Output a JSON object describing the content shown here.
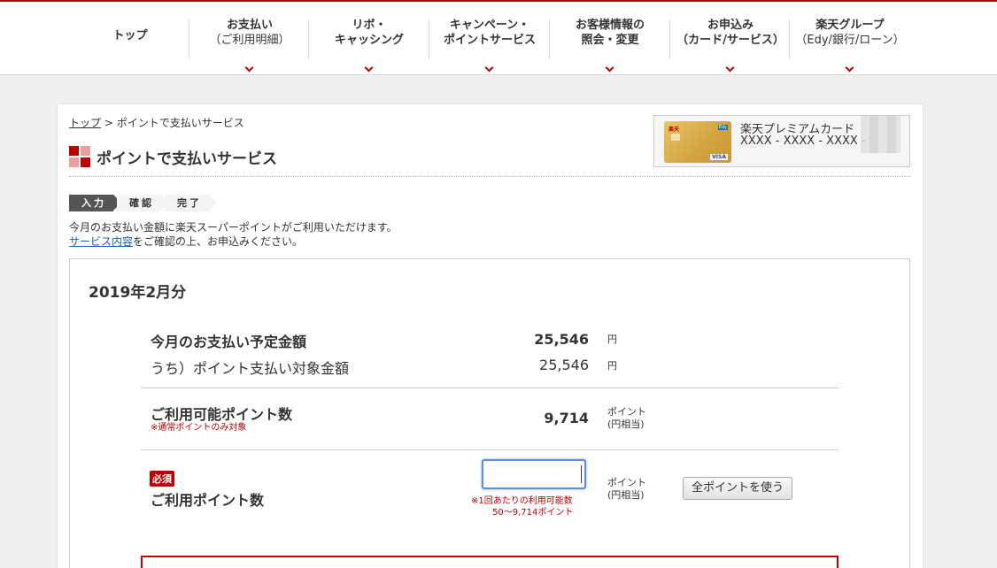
{
  "nav": {
    "items": [
      {
        "l1": "トップ",
        "l2": ""
      },
      {
        "l1": "お支払い",
        "l2": "（ご利用明細）"
      },
      {
        "l1": "リボ・",
        "l2": "キャッシング"
      },
      {
        "l1": "キャンペーン・",
        "l2": "ポイントサービス"
      },
      {
        "l1": "お客様情報の",
        "l2": "照会・変更"
      },
      {
        "l1": "お申込み",
        "l2": "（カード/サービス）"
      },
      {
        "l1": "楽天グループ",
        "l2": "（Edy/銀行/ローン）"
      }
    ]
  },
  "breadcrumb": {
    "home": "トップ",
    "sep": " > ",
    "current": "ポイントで支払いサービス"
  },
  "page_title": "ポイントで支払いサービス",
  "card": {
    "name": "楽天プレミアムカード",
    "number": "XXXX - XXXX - XXXX -",
    "brand_text": "楽天",
    "network": "VISA",
    "edy": "Edy"
  },
  "steps": [
    "入力",
    "確認",
    "完了"
  ],
  "description": {
    "line1": "今月のお支払い金額に楽天スーパーポイントがご利用いただけます。",
    "link": "サービス内容",
    "line2_rest": "をご確認の上、お申込みください。"
  },
  "main": {
    "month": "2019年2月分",
    "scheduled_label": "今月のお支払い予定金額",
    "scheduled_value": "25,546",
    "scheduled_unit": "円",
    "target_label": "うち）ポイント支払い対象金額",
    "target_value": "25,546",
    "target_unit": "円",
    "available_label": "ご利用可能ポイント数",
    "available_note": "※通常ポイントのみ対象",
    "available_value": "9,714",
    "unit_points_l1": "ポイント",
    "unit_points_l2": "(円相当)",
    "required_badge": "必須",
    "use_label": "ご利用ポイント数",
    "input_value": "",
    "input_note_l1": "※1回あたりの利用可能数",
    "input_note_l2": "50〜9,714ポイント",
    "use_all_button": "全ポイントを使う"
  },
  "colors": {
    "accent": "#bf0000",
    "focus": "#5b8fd9"
  }
}
